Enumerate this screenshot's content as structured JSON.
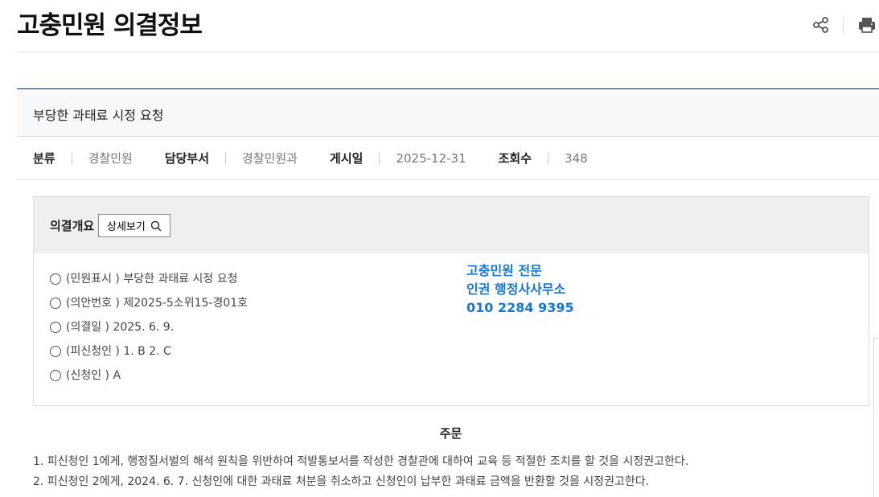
{
  "page": {
    "title": "고충민원 의결정보"
  },
  "actions": {
    "share_icon": "share-icon",
    "print_icon": "print-icon"
  },
  "subject": "부당한 과태료 시정 요청",
  "meta": [
    {
      "label": "분류",
      "value": "경찰민원"
    },
    {
      "label": "담당부서",
      "value": "경찰민원과"
    },
    {
      "label": "게시일",
      "value": "2025-12-31"
    },
    {
      "label": "조회수",
      "value": "348"
    }
  ],
  "summary": {
    "label": "의결개요",
    "detail_button": "상세보기",
    "items": [
      "(민원표시 ) 부당한 과태료 시정 요청",
      "(의안번호 ) 제2025-5소위15-경01호",
      "(의결일 ) 2025. 6. 9.",
      "(피신청인 ) 1. B 2. C",
      "(신청인 ) A"
    ]
  },
  "ad": {
    "line1": "고충민원 전문",
    "line2": "인권 행정사사무소",
    "line3": "010 2284 9395",
    "color": "#1677d2"
  },
  "order": {
    "title": "주문",
    "items": [
      "1. 피신청인 1에게, 행정질서벌의 해석 원칙을 위반하여 적발통보서를 작성한 경찰관에 대하여 교육 등 적절한 조치를 할 것을 시정권고한다.",
      "2. 피신청인 2에게, 2024. 6. 7. 신청인에 대한 과태료 처분을 취소하고 신청인이 납부한 과태료 금액을 반환할 것을 시정권고한다."
    ]
  }
}
